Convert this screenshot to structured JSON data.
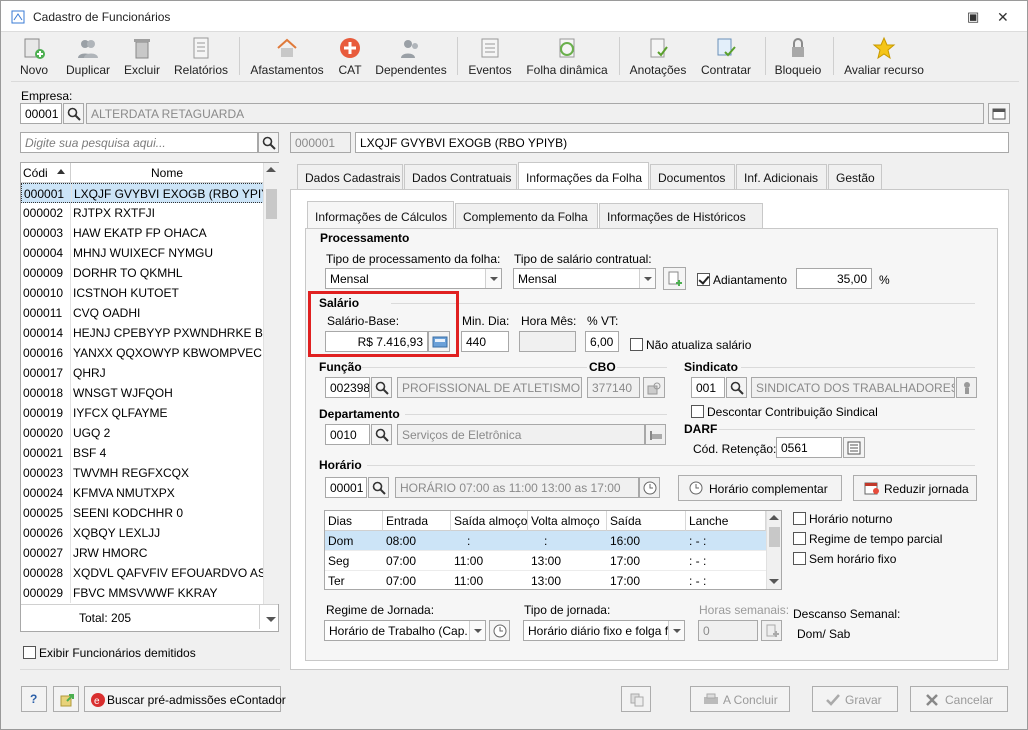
{
  "window": {
    "title": "Cadastro de Funcionários"
  },
  "toolbar": [
    {
      "id": "novo",
      "label": "Novo",
      "icon": "new-user-icon"
    },
    {
      "id": "duplicar",
      "label": "Duplicar",
      "icon": "duplicate-users-icon"
    },
    {
      "id": "excluir",
      "label": "Excluir",
      "icon": "trash-icon"
    },
    {
      "id": "relatorios",
      "label": "Relatórios",
      "icon": "report-icon"
    },
    {
      "id": "afastamentos",
      "label": "Afastamentos",
      "icon": "house-icon"
    },
    {
      "id": "cat",
      "label": "CAT",
      "icon": "red-cross-icon"
    },
    {
      "id": "dependentes",
      "label": "Dependentes",
      "icon": "dependents-icon"
    },
    {
      "id": "eventos",
      "label": "Eventos",
      "icon": "list-icon"
    },
    {
      "id": "folha",
      "label": "Folha dinâmica",
      "icon": "dynamic-sheet-icon"
    },
    {
      "id": "anotacoes",
      "label": "Anotações",
      "icon": "notes-icon"
    },
    {
      "id": "contratar",
      "label": "Contratar",
      "icon": "contract-icon"
    },
    {
      "id": "bloqueio",
      "label": "Bloqueio",
      "icon": "lock-icon"
    },
    {
      "id": "avaliar",
      "label": "Avaliar recurso",
      "icon": "star-icon"
    }
  ],
  "empresa": {
    "label": "Empresa:",
    "code": "00001",
    "name": "ALTERDATA RETAGUARDA"
  },
  "search": {
    "placeholder": "Digite sua pesquisa aqui..."
  },
  "employee": {
    "code": "000001",
    "name": "LXQJF GVYBVI EXOGB (RBO YPIYB)"
  },
  "list": {
    "col_code": "Códi",
    "col_name": "Nome",
    "rows": [
      {
        "code": "000001",
        "name": "LXQJF GVYBVI EXOGB (RBO YPIYB)"
      },
      {
        "code": "000002",
        "name": "RJTPX RXTFJI"
      },
      {
        "code": "000003",
        "name": "HAW EKATP FP OHACA"
      },
      {
        "code": "000004",
        "name": "MHNJ WUIXECF NYMGU"
      },
      {
        "code": "000009",
        "name": "DORHR TO QKMHL"
      },
      {
        "code": "000010",
        "name": "ICSTNOH KUTOET"
      },
      {
        "code": "000011",
        "name": "CVQ OADHI"
      },
      {
        "code": "000014",
        "name": "HEJNJ CPEBYYP PXWNDHRKE BTB J"
      },
      {
        "code": "000016",
        "name": "YANXX QQXOWYP KBWOMPVEC A"
      },
      {
        "code": "000017",
        "name": "QHRJ"
      },
      {
        "code": "000018",
        "name": "WNSGT WJFQOH"
      },
      {
        "code": "000019",
        "name": "IYFCX QLFAYME"
      },
      {
        "code": "000020",
        "name": "UGQ 2"
      },
      {
        "code": "000021",
        "name": "BSF 4"
      },
      {
        "code": "000023",
        "name": "TWVMH REGFXCQX"
      },
      {
        "code": "000024",
        "name": "KFMVA NMUTXPX"
      },
      {
        "code": "000025",
        "name": "SEENI KODCHHR 0"
      },
      {
        "code": "000026",
        "name": "XQBQY LEXLJJ"
      },
      {
        "code": "000027",
        "name": "JRW HMORC"
      },
      {
        "code": "000028",
        "name": "XQDVL QAFVFIV EFOUARDVO AST U"
      },
      {
        "code": "000029",
        "name": "FBVC MMSVWWF KKRAY"
      }
    ],
    "total": "Total: 205"
  },
  "show_dismissed": "Exibir Funcionários demitidos",
  "tabs": [
    "Dados Cadastrais",
    "Dados Contratuais",
    "Informações da Folha",
    "Documentos",
    "Inf. Adicionais",
    "Gestão"
  ],
  "subtabs": [
    "Informações de Cálculos",
    "Complemento da Folha",
    "Informações de  Históricos"
  ],
  "proc": {
    "section": "Processamento",
    "tipo_proc_label": "Tipo de processamento da folha:",
    "tipo_proc": "Mensal",
    "tipo_sal_label": "Tipo de salário contratual:",
    "tipo_sal": "Mensal",
    "adiantamento_label": "Adiantamento",
    "adiantamento": "35,00",
    "percent": "%"
  },
  "salario": {
    "section": "Salário",
    "base_label": "Salário-Base:",
    "base": "R$ 7.416,93",
    "min_dia_label": "Min. Dia:",
    "min_dia": "440",
    "hora_mes_label": "Hora Mês:",
    "hora_mes": "",
    "vt_label": "% VT:",
    "vt": "6,00",
    "nao_atualiza": "Não atualiza salário"
  },
  "funcao": {
    "label": "Função",
    "code": "002398",
    "name": "PROFISSIONAL DE ATLETISMO",
    "cbo_label": "CBO",
    "cbo": "377140"
  },
  "sindicato": {
    "label": "Sindicato",
    "code": "001",
    "name": "SINDICATO DOS TRABALHADORES DE",
    "desconto": "Descontar Contribuição Sindical"
  },
  "departamento": {
    "label": "Departamento",
    "code": "0010",
    "name": "Serviços de Eletrônica"
  },
  "darf": {
    "label": "DARF",
    "cod_label": "Cód. Retenção:",
    "cod": "0561"
  },
  "horario": {
    "label": "Horário",
    "code": "00001",
    "name": "HORÁRIO 07:00 as 11:00  13:00 as 17:00",
    "complementar": "Horário complementar",
    "reduzir": "Reduzir jornada",
    "headers": [
      "Dias",
      "Entrada",
      "Saída almoço",
      "Volta almoço",
      "Saída",
      "Lanche"
    ],
    "rows": [
      [
        "Dom",
        "08:00",
        ":",
        ":",
        "16:00",
        ":  -  :"
      ],
      [
        "Seg",
        "07:00",
        "11:00",
        "13:00",
        "17:00",
        ":  -  :"
      ],
      [
        "Ter",
        "07:00",
        "11:00",
        "13:00",
        "17:00",
        ":  -  :"
      ]
    ],
    "noturno": "Horário noturno",
    "parcial": "Regime de tempo parcial",
    "sem_fixo": "Sem horário fixo"
  },
  "jornada": {
    "regime_label": "Regime de Jornada:",
    "regime": "Horário de Trabalho (Cap.",
    "tipo_label": "Tipo de jornada:",
    "tipo": "Horário diário fixo e folga f",
    "horas_label": "Horas semanais:",
    "horas": "0",
    "descanso_label": "Descanso Semanal:",
    "descanso": "Dom/ Sab"
  },
  "bottom": {
    "help": "?",
    "buscar": "Buscar pré-admissões eContador",
    "concluir": "A Concluir",
    "gravar": "Gravar",
    "cancelar": "Cancelar"
  },
  "colors": {
    "accent": "#0066cc",
    "highlight": "#e02020",
    "selection": "#cce4f7"
  }
}
